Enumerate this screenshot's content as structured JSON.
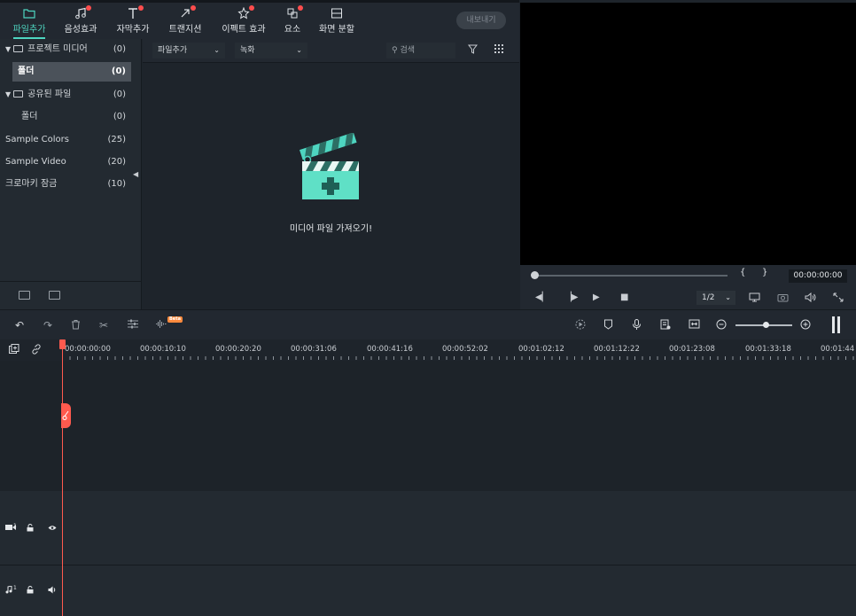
{
  "toolbar": {
    "tabs": [
      {
        "label": "파일추가",
        "icon": "folder-icon",
        "badge": false,
        "active": true
      },
      {
        "label": "음성효과",
        "icon": "music-note-icon",
        "badge": true,
        "active": false
      },
      {
        "label": "자막추가",
        "icon": "text-icon",
        "badge": true,
        "active": false
      },
      {
        "label": "트랜지션",
        "icon": "transition-icon",
        "badge": true,
        "active": false
      },
      {
        "label": "이펙트 효과",
        "icon": "effects-icon",
        "badge": true,
        "active": false
      },
      {
        "label": "요소",
        "icon": "elements-icon",
        "badge": true,
        "active": false
      },
      {
        "label": "화면 분할",
        "icon": "split-screen-icon",
        "badge": false,
        "active": false
      }
    ],
    "export_label": "내보내기"
  },
  "library": {
    "items": [
      {
        "label": "프로젝트 미디어",
        "count": "(0)",
        "icon": "folder-icon",
        "expanded": true
      },
      {
        "label": "폴더",
        "count": "(0)",
        "selected": true
      },
      {
        "label": "공유된 파일",
        "count": "(0)",
        "icon": "folder-icon",
        "expanded": true
      },
      {
        "label": "폴더",
        "count": "(0)"
      },
      {
        "label": "Sample Colors",
        "count": "(25)"
      },
      {
        "label": "Sample Video",
        "count": "(20)"
      },
      {
        "label": "크로마키 잠금",
        "count": "(10)"
      }
    ]
  },
  "media": {
    "import_dropdown": "파일추가",
    "record_dropdown": "녹화",
    "search_placeholder": "검색",
    "empty_message": "미디어 파일 가져오기!"
  },
  "preview": {
    "timecode": "00:00:00:00",
    "mark_in": "{",
    "mark_out": "}",
    "zoom": "1/2"
  },
  "timeline": {
    "beta_label": "Beta",
    "ruler": [
      "00:00:00:00",
      "00:00:10:10",
      "00:00:20:20",
      "00:00:31:06",
      "00:00:41:16",
      "00:00:52:02",
      "00:01:02:12",
      "00:01:12:22",
      "00:01:23:08",
      "00:01:33:18",
      "00:01:44"
    ],
    "tracks": [
      {
        "type": "video",
        "label": "1"
      },
      {
        "type": "audio",
        "label": "1"
      }
    ]
  }
}
